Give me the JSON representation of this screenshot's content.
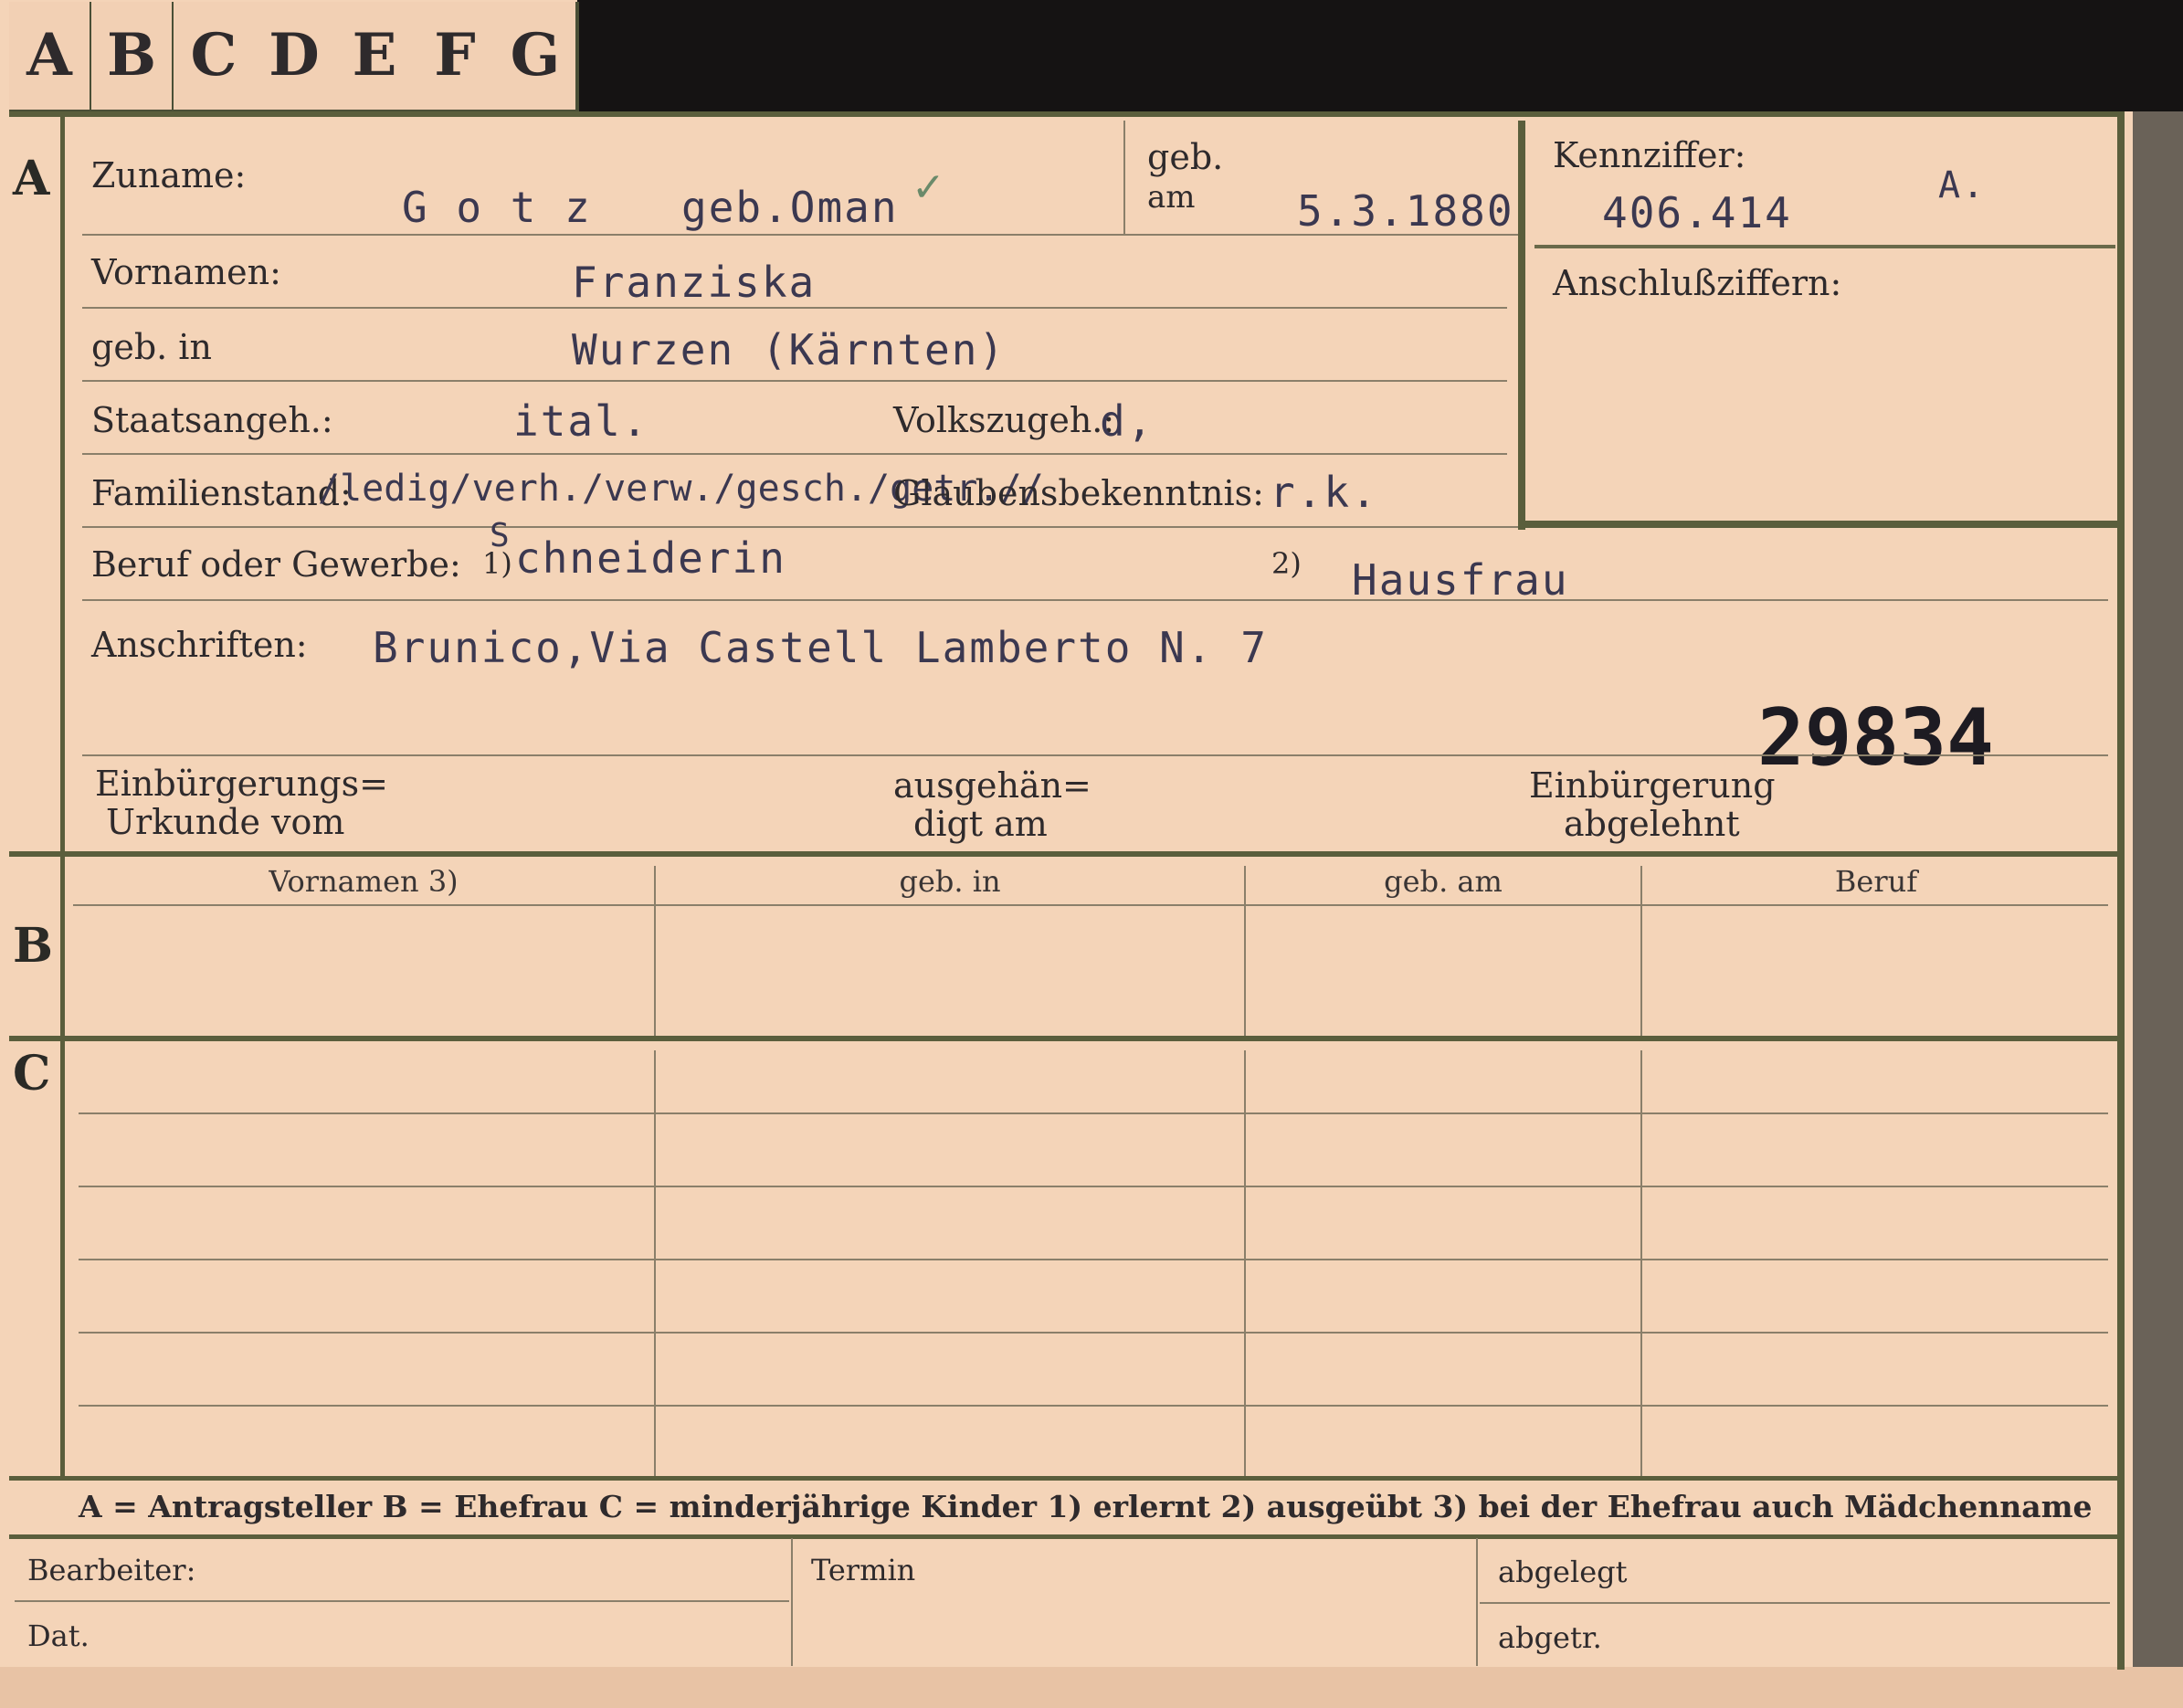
{
  "tabs": [
    "A",
    "B",
    "C",
    "D",
    "E",
    "F",
    "G"
  ],
  "sections": {
    "a": "A",
    "b": "B",
    "c": "C"
  },
  "labels": {
    "zuname": "Zuname:",
    "geb": "geb.",
    "am": "am",
    "kennziffer": "Kennziffer:",
    "anschlussziffern": "Anschlußziffern:",
    "vornamen": "Vornamen:",
    "geb_in": "geb. in",
    "staatsangeh": "Staatsangeh.:",
    "volkszugeh": "Volkszugeh.:",
    "familienstand": "Familienstand:",
    "glaubensbekenntnis": "Glaubensbekenntnis:",
    "beruf": "Beruf oder Gewerbe:",
    "note1": "1)",
    "note2": "2)",
    "anschriften": "Anschriften:",
    "einb_urk_1": "Einbürgerungs=",
    "einb_urk_2": "Urkunde vom",
    "ausgeh_1": "ausgehän=",
    "ausgeh_2": "digt am",
    "abgelehnt_1": "Einbürgerung",
    "abgelehnt_2": "abgelehnt"
  },
  "values": {
    "zuname": "G o t z",
    "zuname_extra": "geb.Oman",
    "checkmark": "✓",
    "geb_am": "5.3.1880",
    "kennziffer": "406.414",
    "kennziffer_suffix": "A.",
    "vornamen": "Franziska",
    "geb_in": "Wurzen (Kärnten)",
    "staatsangeh": "ital.",
    "volkszugeh": "d,",
    "familienstand_options": "/ledig/verh./verw./gesch./getr.//",
    "glaubensbekenntnis": "r.k.",
    "beruf_1_correction": "S",
    "beruf_1": "chneiderin",
    "beruf_2": "Hausfrau",
    "anschriften": "Brunico,Via Castell Lamberto N. 7",
    "number": "29834"
  },
  "table_b": {
    "headers": [
      "Vornamen 3)",
      "geb. in",
      "geb. am",
      "Beruf"
    ]
  },
  "legend": "A = Antragsteller   B = Ehefrau   C = minderjährige Kinder   1) erlernt   2) ausgeübt   3) bei der Ehefrau auch Mädchenname",
  "footer": {
    "bearbeiter": "Bearbeiter:",
    "dat": "Dat.",
    "termin": "Termin",
    "abgelegt": "abgelegt",
    "abgetr": "abgetr."
  }
}
